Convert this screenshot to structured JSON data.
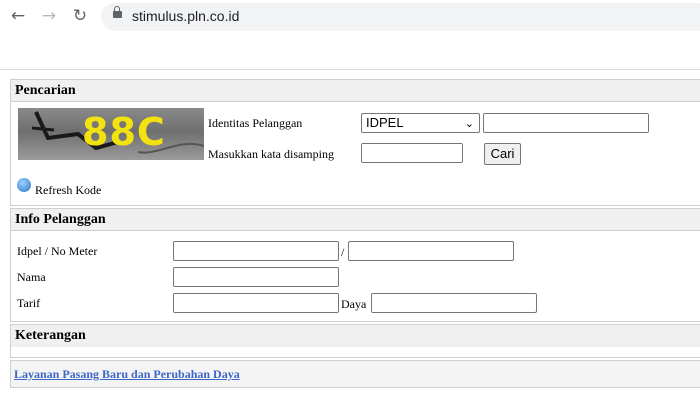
{
  "browser": {
    "back_icon": "←",
    "forward_icon": "→",
    "reload_icon": "↻",
    "url": "stimulus.pln.co.id"
  },
  "pencarian": {
    "title": "Pencarian",
    "captcha_text": "88C",
    "identitas_label": "Identitas Pelanggan",
    "identitas_select": "IDPEL",
    "identitas_value": "",
    "kata_label": "Masukkan kata disamping",
    "kata_value": "",
    "cari_button": "Cari",
    "refresh_label": "Refresh Kode"
  },
  "info": {
    "title": "Info Pelanggan",
    "idpel_label": "Idpel / No Meter",
    "separator": "/",
    "nama_label": "Nama",
    "tarif_label": "Tarif",
    "daya_label": "Daya"
  },
  "keterangan": {
    "title": "Keterangan"
  },
  "footer": {
    "link": "Layanan Pasang Baru dan Perubahan Daya"
  }
}
